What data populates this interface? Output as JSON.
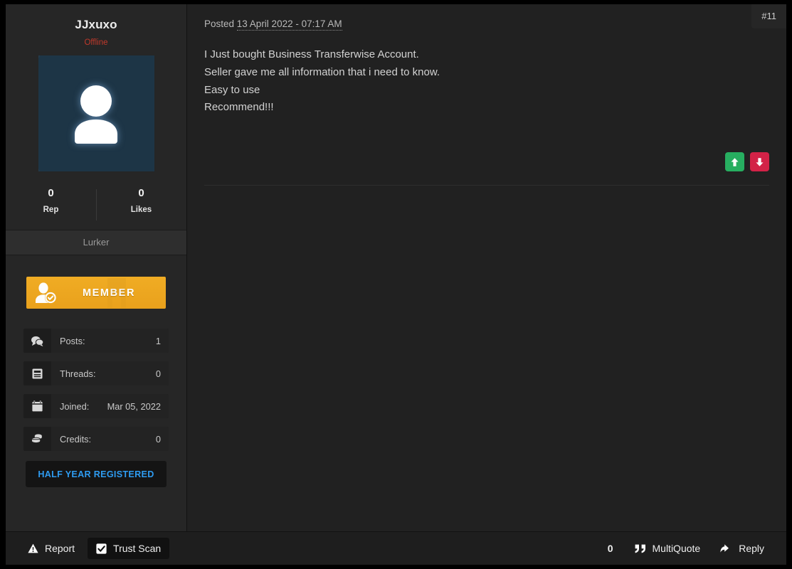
{
  "sidebar": {
    "username": "JJxuxo",
    "status": "Offline",
    "avatar_icon": "user-silhouette-icon",
    "counts": [
      {
        "value": "0",
        "label": "Rep"
      },
      {
        "value": "0",
        "label": "Likes"
      }
    ],
    "usergroup": "Lurker",
    "rank_badge": {
      "label": "MEMBER",
      "icon": "member-verified-icon",
      "color": "#eaa41e"
    },
    "stats": [
      {
        "icon": "comments-icon",
        "key": "Posts:",
        "value": "1"
      },
      {
        "icon": "threads-icon",
        "key": "Threads:",
        "value": "0"
      },
      {
        "icon": "calendar-icon",
        "key": "Joined:",
        "value": "Mar 05, 2022"
      },
      {
        "icon": "coins-icon",
        "key": "Credits:",
        "value": "0"
      }
    ],
    "award_badge": {
      "label": "HALF YEAR REGISTERED",
      "color": "#2e9bf0"
    }
  },
  "post": {
    "posted_prefix": "Posted ",
    "posted_date": "13 April 2022 - 07:17 AM",
    "post_number": "#11",
    "body_lines": [
      "I Just bought Business Transferwise Account.",
      "Seller gave me all information that i need to know.",
      "Easy to use",
      "Recommend!!!"
    ],
    "vote_up": {
      "icon": "arrow-up-icon",
      "color": "#27ae60"
    },
    "vote_down": {
      "icon": "arrow-down-icon",
      "color": "#d32247"
    }
  },
  "footer": {
    "report": {
      "label": "Report",
      "icon": "warning-triangle-icon"
    },
    "trust_scan": {
      "label": "Trust Scan",
      "icon": "checkbox-checked-icon"
    },
    "quote_count": "0",
    "multiquote": {
      "label": "MultiQuote",
      "icon": "quote-icon"
    },
    "reply": {
      "label": "Reply",
      "icon": "reply-arrow-icon"
    }
  }
}
